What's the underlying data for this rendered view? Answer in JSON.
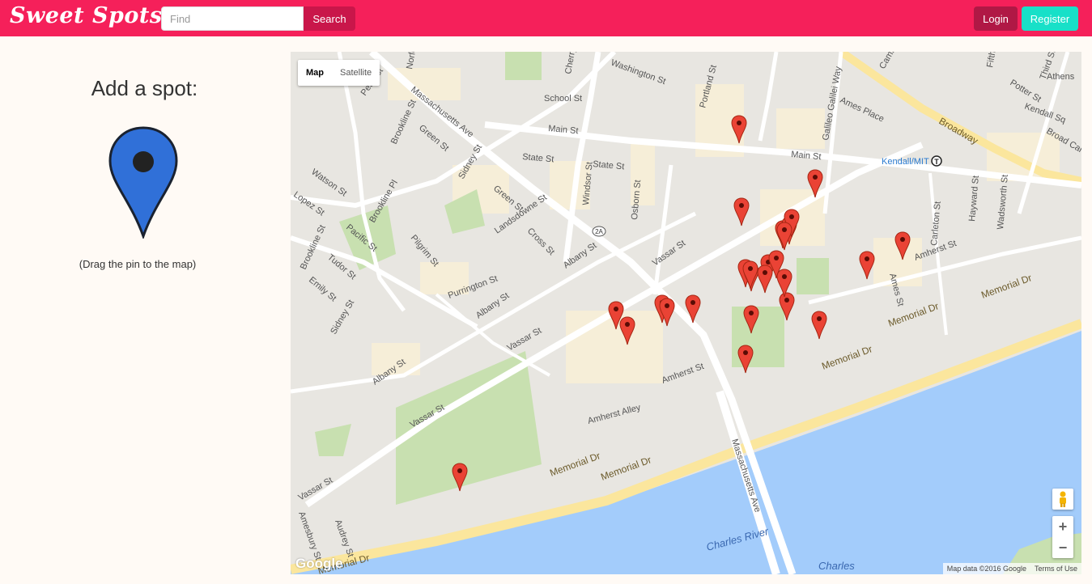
{
  "header": {
    "brand": "Sweet Spots",
    "find_placeholder": "Find",
    "search_label": "Search",
    "login_label": "Login",
    "register_label": "Register"
  },
  "sidebar": {
    "title": "Add a spot:",
    "hint": "(Drag the pin to the map)"
  },
  "map": {
    "type_buttons": [
      "Map",
      "Satellite"
    ],
    "attribution": "Map data ©2016 Google",
    "terms": "Terms of Use",
    "logo": "Google",
    "zoom_in": "+",
    "zoom_out": "−",
    "station_label": "Kendall/MIT",
    "route_shield": "2A",
    "water_labels": [
      "Charles River",
      "Charles"
    ],
    "street_labels": [
      "Washington St",
      "School St",
      "Main St",
      "Main St",
      "State St",
      "State St",
      "Massachusetts Ave",
      "Massachusetts Ave",
      "Broadway",
      "Ames Place",
      "Potter St",
      "Broad Canal",
      "Kendall Sq",
      "Third St",
      "Athens",
      "Fifth St",
      "Portland St",
      "Galileo Galilei Way",
      "Windsor St",
      "Osborn St",
      "Sidney St",
      "Sidney St",
      "Green St",
      "Green St",
      "Brookline St",
      "Brookline Pl",
      "Brookline St",
      "Watson St",
      "Lopez St",
      "Pacific St",
      "Tudor St",
      "Emily St",
      "Pilgrim St",
      "Landsdowne St",
      "Cross St",
      "Albany St",
      "Albany St",
      "Albany St",
      "Purrington St",
      "Vassar St",
      "Vassar St",
      "Vassar St",
      "Vassar St",
      "Amherst St",
      "Amherst St",
      "Amherst Alley",
      "Memorial Dr",
      "Memorial Dr",
      "Memorial Dr",
      "Memorial Dr",
      "Memorial Dr",
      "Ames St",
      "Carleton St",
      "Hayward St",
      "Wadsworth St",
      "Amesbury St",
      "Audrey St",
      "Norfolk St",
      "Pearl St",
      "Cherry St",
      "Cambridge St"
    ],
    "marker_count": 26
  },
  "colors": {
    "brand": "#f5205a",
    "search_button": "#c9164a",
    "login_button": "#b01845",
    "register_button": "#18e0c8",
    "water": "#a3ccfb",
    "park": "#c8e0b0",
    "marker_red": "#ea4335",
    "drag_pin_blue": "#3070d8"
  },
  "icons": [
    "map-marker-icon",
    "drag-pin-icon",
    "pegman-icon",
    "transit-icon"
  ]
}
